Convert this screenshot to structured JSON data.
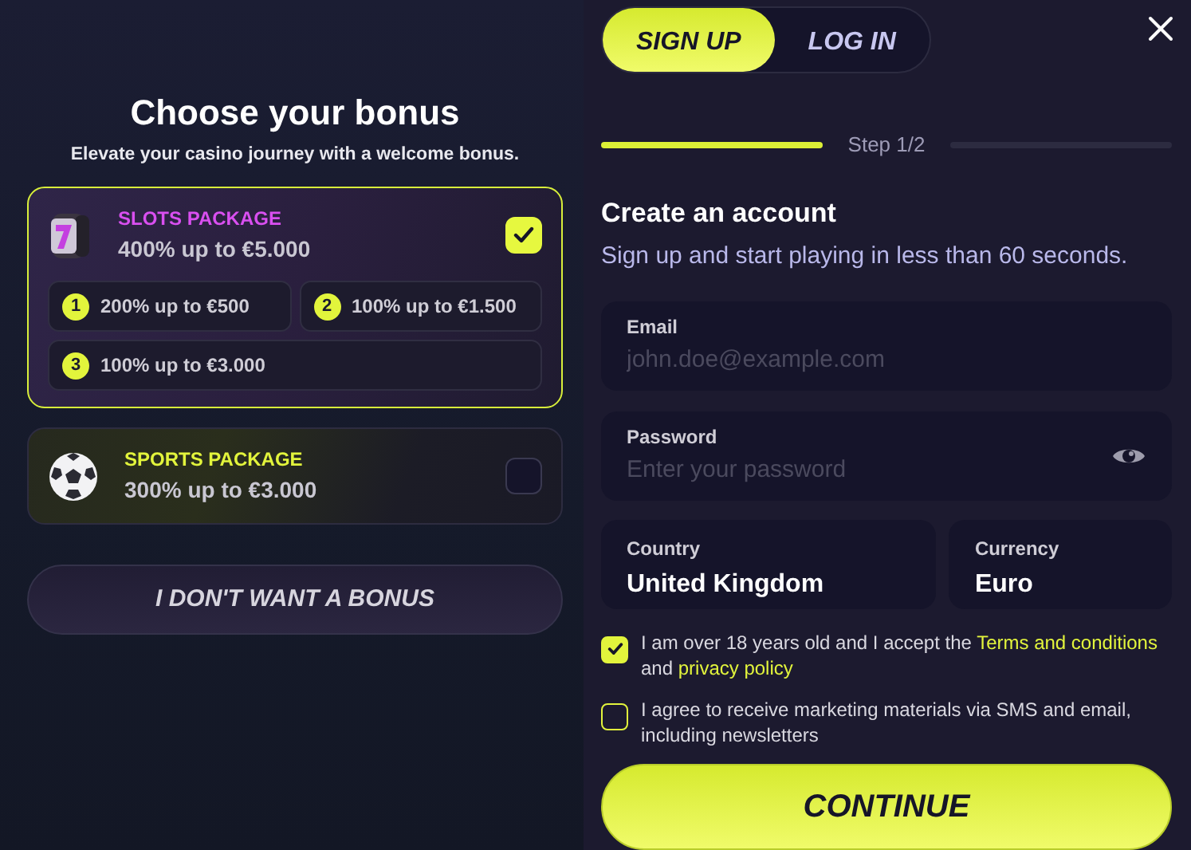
{
  "bonus": {
    "title": "Choose your bonus",
    "subtitle": "Elevate your casino journey with a welcome bonus.",
    "packages": [
      {
        "kind": "slots",
        "name": "SLOTS PACKAGE",
        "offer": "400% up to €5.000",
        "selected": true,
        "tiers": [
          {
            "number": "1",
            "text": "200% up to €500"
          },
          {
            "number": "2",
            "text": "100% up to €1.500"
          },
          {
            "number": "3",
            "text": "100% up to €3.000"
          }
        ]
      },
      {
        "kind": "sports",
        "name": "SPORTS PACKAGE",
        "offer": "300% up to €3.000",
        "selected": false
      }
    ],
    "decline_button": "I DON'T WANT A BONUS"
  },
  "auth": {
    "tabs": [
      {
        "label": "SIGN UP",
        "selected": true
      },
      {
        "label": "LOG IN",
        "selected": false
      }
    ],
    "steps": [
      {
        "completed": true
      },
      {
        "completed": false
      }
    ],
    "step_label": "Step 1/2",
    "heading": "Create an account",
    "subheading": "Sign up and start playing in less than 60 seconds.",
    "fields": [
      {
        "kind": "email",
        "label": "Email",
        "placeholder": "john.doe@example.com"
      },
      {
        "kind": "password",
        "label": "Password",
        "placeholder": "Enter your password"
      }
    ],
    "selects": [
      {
        "label": "Country",
        "value": "United Kingdom"
      },
      {
        "label": "Currency",
        "value": "Euro"
      }
    ],
    "consents": [
      {
        "checked": true,
        "segments": [
          {
            "kind": "text",
            "text": "I am over 18 years old and I accept the "
          },
          {
            "kind": "link",
            "text": "Terms and conditions"
          },
          {
            "kind": "text",
            "text": " and "
          },
          {
            "kind": "link",
            "text": "privacy policy"
          }
        ]
      },
      {
        "checked": false,
        "segments": [
          {
            "kind": "text",
            "text": "I agree to receive marketing materials via SMS and email, including newsletters"
          }
        ]
      }
    ],
    "continue_button": "CONTINUE"
  }
}
